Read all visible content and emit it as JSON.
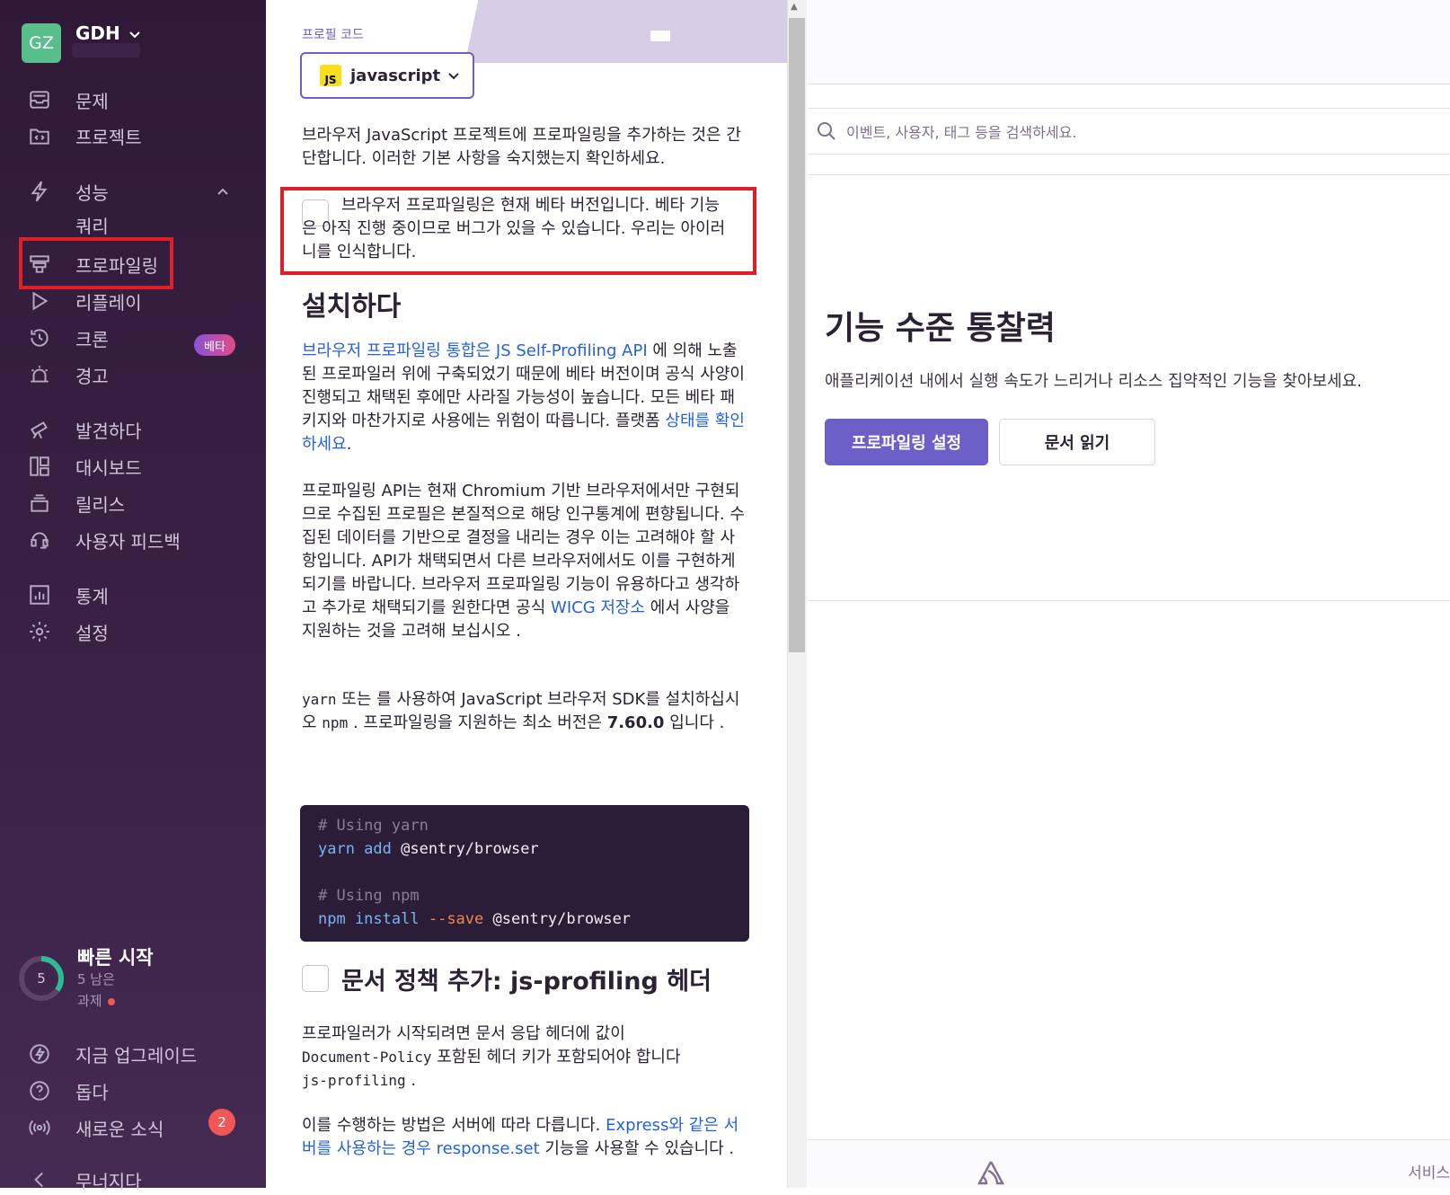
{
  "org": {
    "initials": "GZ",
    "name": "GDH"
  },
  "nav": {
    "issues": "문제",
    "projects": "프로젝트",
    "performance": "성능",
    "queries": "쿼리",
    "profiling": "프로파일링",
    "replays": "리플레이",
    "crons": "크론",
    "crons_badge": "베타",
    "alerts": "경고",
    "discover": "발견하다",
    "dashboards": "대시보드",
    "releases": "릴리스",
    "feedback": "사용자 피드백",
    "stats": "통계",
    "settings": "설정"
  },
  "quickstart": {
    "count": "5",
    "title": "빠른 시작",
    "sub1": "5 남은",
    "sub2": "과제",
    "progress": 0.35
  },
  "bottom_nav": {
    "upgrade": "지금 업그레이드",
    "help": "돕다",
    "news": "새로운 소식",
    "news_count": "2",
    "collapse": "무너지다"
  },
  "main": {
    "platform_label": "프로필 코드",
    "platform_value": "javascript",
    "intro": "브라우저 JavaScript 프로젝트에 프로파일링을 추가하는 것은 간단합니다. 이러한 기본 사항을 숙지했는지 확인하세요.",
    "beta_alert": "브라우저 프로파일링은 현재 베타 버전입니다. 베타 기능은 아직 진행 중이므로 버그가 있을 수 있습니다. 우리는 아이러니를 인식합니다.",
    "install_heading": "설치하다",
    "p1_link1": "브라우저 프로파일링 통합은",
    "p1_link2": "JS Self-Profiling API",
    "p1_text": "에 의해 노출된 프로파일러 위에 구축되었기 때문에 베타 버전이며 공식 사양이 진행되고 채택된 후에만 사라질 가능성이 높습니다. 모든 베타 패키지와 마찬가지로 사용에는 위험이 따릅니다. 플랫폼",
    "p1_link3": "상태를 확인하세요",
    "p1_end": ".",
    "p2_text": "프로파일링 API는 현재 Chromium 기반 브라우저에서만 구현되므로 수집된 프로필은 본질적으로 해당 인구통계에 편향됩니다. 수집된 데이터를 기반으로 결정을 내리는 경우 이는 고려해야 할 사항입니다. API가 채택되면서 다른 브라우저에서도 이를 구현하게 되기를 바랍니다. 브라우저 프로파일링 기능이 유용하다고 생각하고 추가로 채택되기를 원한다면 공식",
    "p2_link": "WICG 저장소",
    "p2_end": "에서 사양을 지원하는 것을 고려해 보십시오 .",
    "p3_a": "yarn",
    "p3_b": "또는 를 사용하여 JavaScript 브라우저 SDK를 설치하십시오",
    "p3_c": "npm",
    "p3_d": ". 프로파일링을 지원하는 최소 버전은",
    "p3_version": "7.60.0",
    "p3_e": "입니다 .",
    "code": {
      "c1": "# Using yarn",
      "l1_cmd": "yarn add",
      "l1_pkg": "@sentry/browser",
      "c2": "# Using npm",
      "l2_cmd": "npm install",
      "l2_flag": "--save",
      "l2_pkg": "@sentry/browser"
    },
    "policy_heading": "문서 정책 추가: js-profiling 헤더",
    "p4_a": "프로파일러가 시작되려면 문서 응답 헤더에 값이",
    "p4_code1": "Document-Policy",
    "p4_b": "포함된 헤더 키가 포함되어야 합니다",
    "p4_code2": "js-profiling",
    "p4_c": ".",
    "p5_a": "이를 수행하는 방법은 서버에 따라 다릅니다.",
    "p5_link": "Express와 같은 서버를 사용하는 경우 response.set",
    "p5_b": "기능을 사용할 수 있습니다 ."
  },
  "right": {
    "search_placeholder": "이벤트, 사용자, 태그 등을 검색하세요.",
    "title": "기능 수준 통찰력",
    "description": "애플리케이션 내에서 실행 속도가 느리거나 리소스 집약적인 기능을 찾아보세요.",
    "primary_button": "프로파일링 설정",
    "secondary_button": "문서 읽기",
    "footer_text": "서비스"
  }
}
